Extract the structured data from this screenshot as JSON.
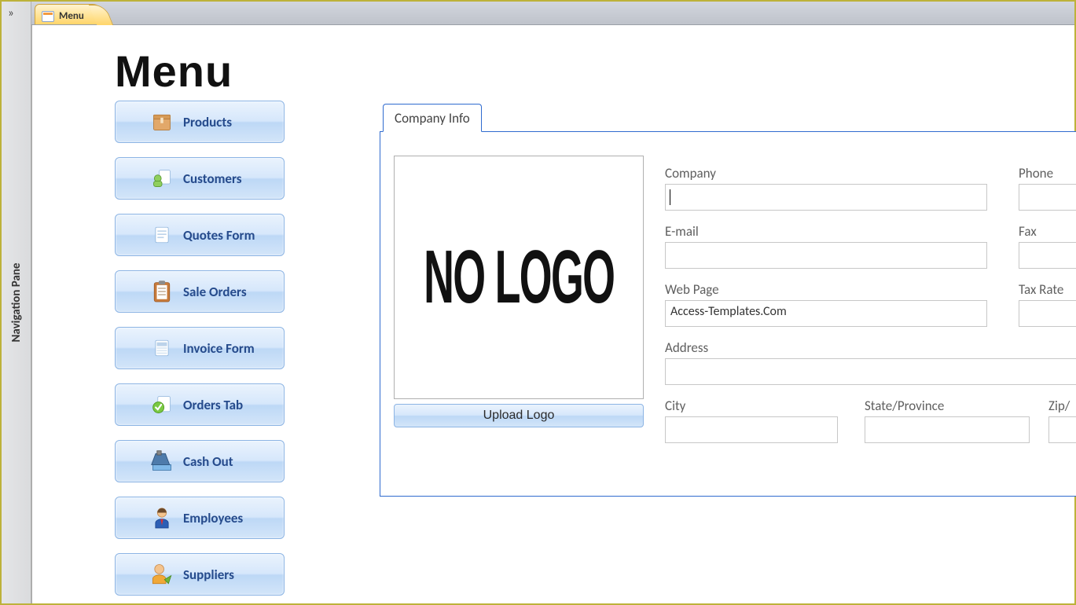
{
  "nav_pane": {
    "label": "Navigation Pane",
    "expand": "»"
  },
  "tab": {
    "label": "Menu"
  },
  "page": {
    "title": "Menu"
  },
  "menu": {
    "items": [
      {
        "label": "Products"
      },
      {
        "label": "Customers"
      },
      {
        "label": "Quotes Form"
      },
      {
        "label": "Sale Orders"
      },
      {
        "label": "Invoice Form"
      },
      {
        "label": "Orders Tab"
      },
      {
        "label": "Cash Out"
      },
      {
        "label": "Employees"
      },
      {
        "label": "Suppliers"
      }
    ]
  },
  "panel": {
    "tab_label": "Company Info",
    "logo_placeholder": "NO LOGO",
    "upload_label": "Upload Logo",
    "fields": {
      "company": {
        "label": "Company",
        "value": ""
      },
      "email": {
        "label": "E-mail",
        "value": ""
      },
      "webpage": {
        "label": "Web Page",
        "value": "Access-Templates.Com"
      },
      "address": {
        "label": "Address",
        "value": ""
      },
      "city": {
        "label": "City",
        "value": ""
      },
      "state": {
        "label": "State/Province",
        "value": ""
      },
      "zip": {
        "label": "Zip/",
        "value": ""
      },
      "phone": {
        "label": "Phone",
        "value": ""
      },
      "fax": {
        "label": "Fax",
        "value": ""
      },
      "taxrate": {
        "label": "Tax Rate",
        "value": ""
      }
    }
  }
}
